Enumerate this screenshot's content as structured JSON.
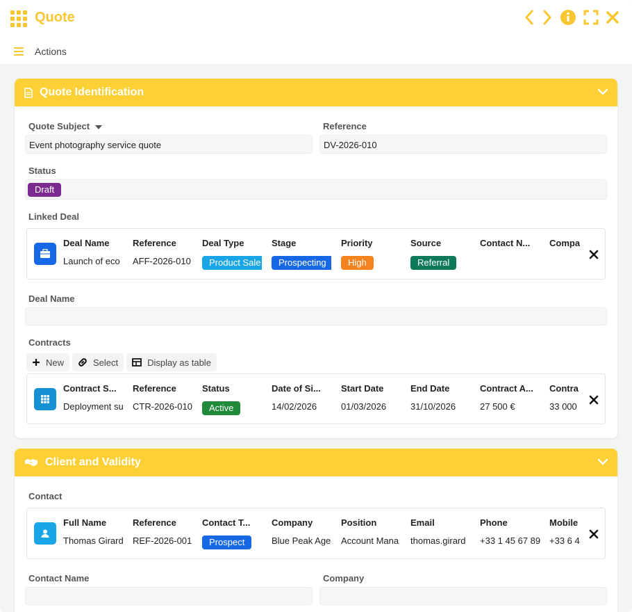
{
  "window": {
    "title": "Quote"
  },
  "toolbar": {
    "actions_label": "Actions"
  },
  "section1": {
    "title": "Quote Identification",
    "quote_subject_label": "Quote Subject",
    "quote_subject_value": "Event photography service quote",
    "reference_label": "Reference",
    "reference_value": "DV-2026-010",
    "status_label": "Status",
    "status_value": "Draft",
    "status_color": "#7b2a8f",
    "linked_deal_label": "Linked Deal",
    "linked_deal": {
      "headers": [
        "Deal Name",
        "Reference",
        "Deal Type",
        "Stage",
        "Priority",
        "Source",
        "Contact N...",
        "Compa"
      ],
      "values": [
        "Launch of eco",
        "AFF-2026-010",
        "Product Sale",
        "Prospecting",
        "High",
        "Referral",
        "",
        ""
      ]
    },
    "deal_name_label": "Deal Name",
    "deal_name_value": "",
    "contracts_label": "Contracts",
    "buttons": {
      "new": "New",
      "select": "Select",
      "table": "Display as table"
    },
    "contract": {
      "headers": [
        "Contract S...",
        "Reference",
        "Status",
        "Date of Si...",
        "Start Date",
        "End Date",
        "Contract A...",
        "Contra"
      ],
      "values": [
        "Deployment su",
        "CTR-2026-010",
        "Active",
        "14/02/2026",
        "01/03/2026",
        "31/10/2026",
        "27 500 €",
        "33 000"
      ]
    }
  },
  "section2": {
    "title": "Client and Validity",
    "contact_label": "Contact",
    "contact": {
      "headers": [
        "Full Name",
        "Reference",
        "Contact T...",
        "Company",
        "Position",
        "Email",
        "Phone",
        "Mobile"
      ],
      "values": [
        "Thomas Girard",
        "REF-2026-001",
        "Prospect",
        "Blue Peak Age",
        "Account Mana",
        "thomas.girard",
        "+33 1 45 67 89",
        "+33 6 4"
      ]
    },
    "contact_name_label": "Contact Name",
    "company_label": "Company"
  },
  "colors": {
    "accent": "#fdd135",
    "product_sale": "#1aa6e6",
    "prospecting": "#1668e6",
    "high": "#f5831f",
    "referral": "#0e7a5a",
    "active": "#1f8a3a",
    "prospect": "#1668e6"
  }
}
